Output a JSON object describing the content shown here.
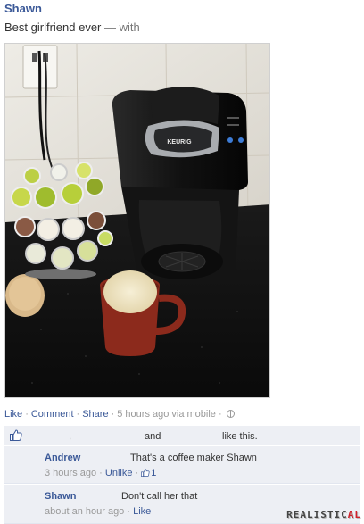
{
  "post": {
    "author": "Shawn",
    "status_text": "Best girlfriend ever",
    "with_text": "— with",
    "brand_logo": "KEURIG"
  },
  "actions": {
    "like": "Like",
    "comment": "Comment",
    "share": "Share",
    "timestamp": "5 hours ago via mobile",
    "separator": "·",
    "privacy_icon": "globe-icon"
  },
  "likes": {
    "comma": ",",
    "and": "and",
    "suffix": "like this.",
    "icon": "thumbs-up-icon"
  },
  "comments": [
    {
      "name": "Andrew",
      "text": "That's a coffee maker Shawn",
      "time": "3 hours ago",
      "action": "Unlike",
      "like_count": "1"
    },
    {
      "name": "Shawn",
      "text": "Don't call her that",
      "time": "about an hour ago",
      "action": "Like"
    }
  ],
  "watermark": {
    "main": "REALISTIC",
    "accent": "AL"
  },
  "colors": {
    "link": "#3b5998",
    "panel": "#edeff4",
    "muted": "#999999"
  }
}
